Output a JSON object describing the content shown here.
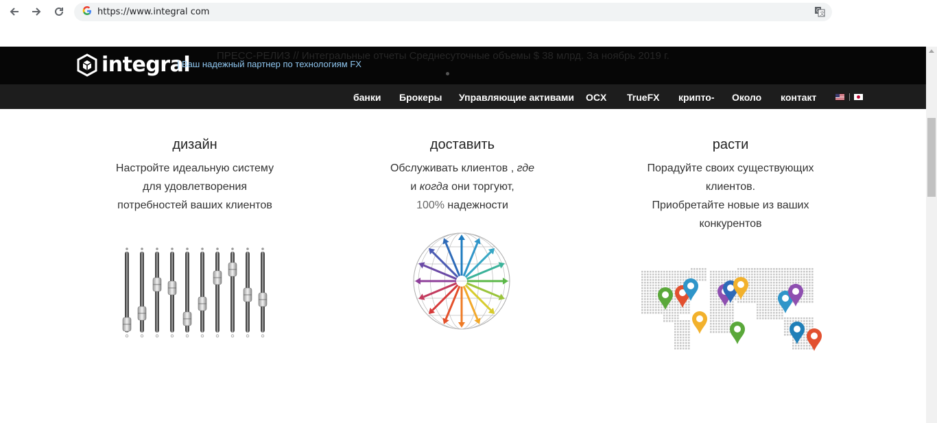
{
  "browser": {
    "url": "https://www.integral com",
    "back_icon": "arrow-left-icon",
    "forward_icon": "arrow-right-icon",
    "reload_icon": "reload-icon",
    "site_icon": "google-icon",
    "translate_icon": "translate-icon"
  },
  "header": {
    "logo_text": "integral",
    "tagline": "| Ваш надежный партнер по технологиям FX",
    "press_release": "ПРЕСС-РЕЛИЗ // Интегральные отчеты Среднесуточные объемы $ 38 млрд. За ноябрь 2019 г."
  },
  "nav": {
    "items": [
      "банки",
      "Брокеры",
      "Управляющие активами",
      "OCX",
      "TrueFX",
      "крипто-",
      "Около",
      "контакт"
    ],
    "flags": [
      "us-flag-icon",
      "jp-flag-icon"
    ]
  },
  "columns": [
    {
      "title": "дизайн",
      "lines": [
        "Настройте идеальную систему",
        "для удовлетворения",
        "потребностей ваших клиентов"
      ],
      "image": "mixer-sliders-icon"
    },
    {
      "title": "доставить",
      "line1_a": "Обслуживать клиентов , ",
      "line1_em": "где",
      "line2_em": "когда",
      "line2_b": " они торгуют,",
      "line3_num": "100%",
      "line3_b": " надежности",
      "prefix_and": "и ",
      "image": "globe-arrows-icon"
    },
    {
      "title": "расти",
      "lines": [
        "Порадуйте своих существующих",
        "клиентов.",
        "Приобретайте новые из ваших",
        "конкурентов"
      ],
      "image": "world-map-pins-icon"
    }
  ],
  "colors": {
    "header_bg": "#060606",
    "nav_bg": "#1d1d1d",
    "tagline": "#8fc6ef"
  }
}
